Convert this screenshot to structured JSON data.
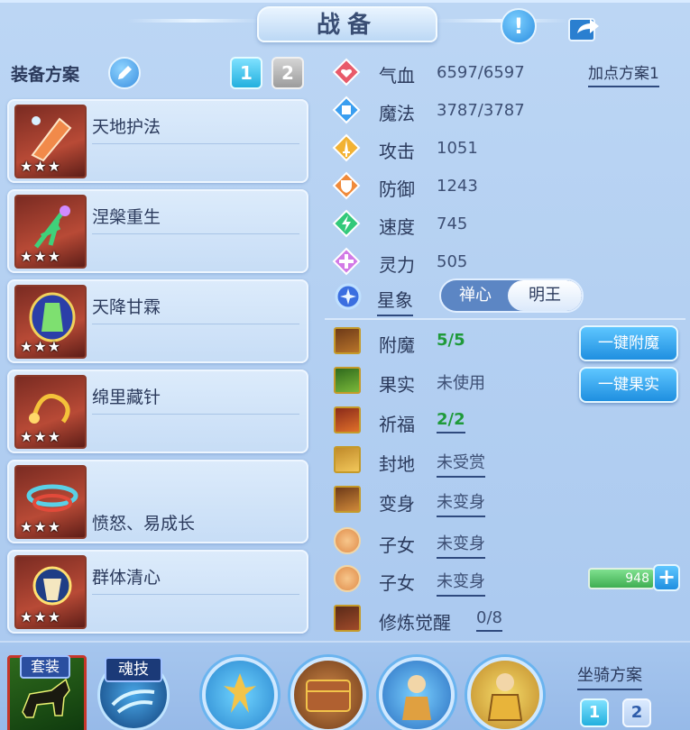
{
  "header": {
    "title": "战备"
  },
  "left": {
    "scheme_label": "装备方案",
    "scheme_tabs": [
      "1",
      "2"
    ],
    "equipment": [
      {
        "name": "天地护法",
        "stars": "★★★"
      },
      {
        "name": "涅槃重生",
        "stars": "★★★"
      },
      {
        "name": "天降甘霖",
        "stars": "★★★"
      },
      {
        "name": "绵里藏针",
        "stars": "★★★"
      },
      {
        "name": "",
        "subtext": "愤怒、易成长",
        "stars": "★★★"
      },
      {
        "name": "群体清心",
        "stars": "★★★"
      }
    ]
  },
  "stats": {
    "add_point_scheme": "加点方案1",
    "rows": [
      {
        "label": "气血",
        "value": "6597/6597"
      },
      {
        "label": "魔法",
        "value": "3787/3787"
      },
      {
        "label": "攻击",
        "value": "1051"
      },
      {
        "label": "防御",
        "value": "1243"
      },
      {
        "label": "速度",
        "value": "745"
      },
      {
        "label": "灵力",
        "value": "505"
      }
    ],
    "constellation": {
      "label": "星象",
      "options": [
        "禅心",
        "明王"
      ],
      "selected": "明王"
    }
  },
  "misc": {
    "rows": [
      {
        "label": "附魔",
        "value": "5/5"
      },
      {
        "label": "果实",
        "value": "未使用"
      },
      {
        "label": "祈福",
        "value": "2/2"
      },
      {
        "label": "封地",
        "value": "未受赏"
      },
      {
        "label": "变身",
        "value": "未变身"
      },
      {
        "label": "子女",
        "value": "未变身"
      },
      {
        "label": "子女",
        "value": "未变身"
      },
      {
        "label": "修炼觉醒",
        "value": "0/8"
      }
    ],
    "btn_enchant": "一键附魔",
    "btn_fruit": "一键果实",
    "bar_value": "948",
    "plus": "+"
  },
  "bottom": {
    "suit_label": "套装",
    "soul_label": "魂技",
    "mount_label": "坐骑方案",
    "mount_tabs": [
      "1",
      "2"
    ]
  },
  "colors": {
    "accent": "#22b0de",
    "green_value": "#1f9a3a",
    "bg": "#a9c8ef"
  }
}
